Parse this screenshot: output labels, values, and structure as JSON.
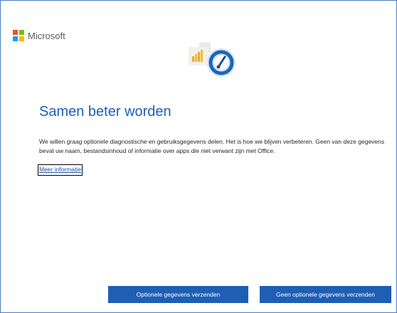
{
  "brand": {
    "name": "Microsoft",
    "colors": [
      "#f25022",
      "#7fba00",
      "#00a4ef",
      "#ffb900"
    ]
  },
  "hero": {
    "icon": "diagnostics-gauge-icon"
  },
  "title": "Samen beter worden",
  "description": "We willen graag optionele diagnostische en gebruiksgegevens delen. Het is hoe we blijven verbeteren. Geen van deze gegevens bevat uw naam, bestandsinhoud of informatie over apps die niet verwant zijn met Office.",
  "link": "Meer informatie",
  "buttons": {
    "send": "Optionele gegevens verzenden",
    "no_send": "Geen optionele gegevens verzenden"
  },
  "colors": {
    "accent": "#1e5fb4",
    "title": "#1e5fb4",
    "link": "#1b4f9c"
  }
}
